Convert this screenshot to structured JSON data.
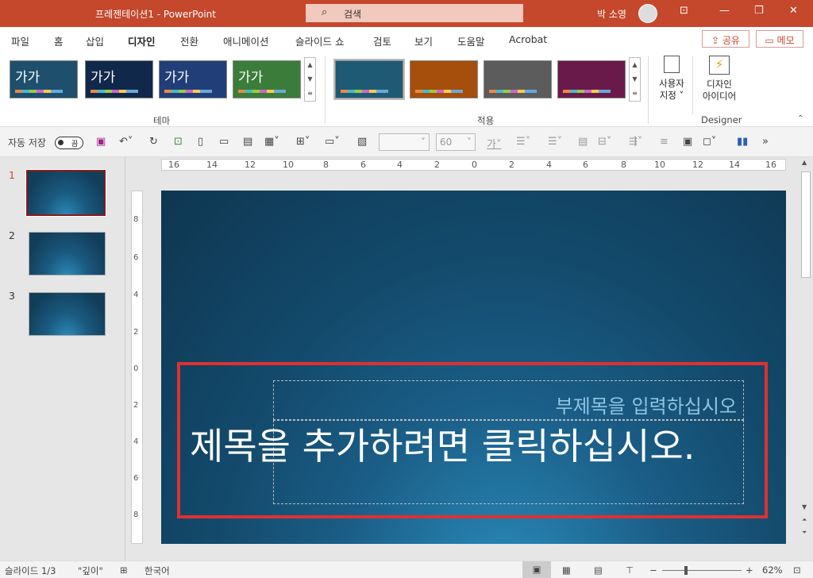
{
  "title_bar": {
    "doc_name": "프레젠테이션1",
    "separator": "-",
    "app": "PowerPoint",
    "search_placeholder": "검색",
    "user": "박 소영"
  },
  "tabs": [
    "파일",
    "홈",
    "삽입",
    "디자인",
    "전환",
    "애니메이션",
    "슬라이드 쇼",
    "검토",
    "보기",
    "도움말",
    "Acrobat"
  ],
  "active_tab": "디자인",
  "share_label": "공유",
  "memo_label": "메모",
  "ribbon": {
    "themes": [
      {
        "label": "가가",
        "bg": "#1e4f6c"
      },
      {
        "label": "가가",
        "bg": "#10284a"
      },
      {
        "label": "가가",
        "bg": "#223e78"
      },
      {
        "label": "가가",
        "bg": "#3c7c3a"
      }
    ],
    "theme_group": "테마",
    "variants": [
      {
        "bg": "#1f5a74"
      },
      {
        "bg": "#a64e0c"
      },
      {
        "bg": "#5c5c5c"
      },
      {
        "bg": "#6a1a4a"
      }
    ],
    "variant_group": "적용",
    "customize_label": [
      "사용자",
      "지정"
    ],
    "designer_label": [
      "디자인",
      "아이디어"
    ],
    "designer_group": "Designer"
  },
  "qat": {
    "autosave": "자동 저장",
    "toggle": "끔",
    "font_size": "60",
    "font_letter": "가"
  },
  "slides": [
    {
      "num": "1"
    },
    {
      "num": "2"
    },
    {
      "num": "3"
    }
  ],
  "slide": {
    "subtitle_placeholder": "부제목을 입력하십시오",
    "title_placeholder": "제목을 추가하려면 클릭하십시오."
  },
  "ruler_h": [
    "16",
    "14",
    "12",
    "10",
    "8",
    "6",
    "4",
    "2",
    "0",
    "2",
    "4",
    "6",
    "8",
    "10",
    "12",
    "14",
    "16"
  ],
  "ruler_v": [
    "8",
    "6",
    "4",
    "2",
    "0",
    "2",
    "4",
    "6",
    "8"
  ],
  "status": {
    "slide": "슬라이드 1/3",
    "theme": "\"깊이\"",
    "lang": "한국어",
    "zoom": "62%"
  }
}
